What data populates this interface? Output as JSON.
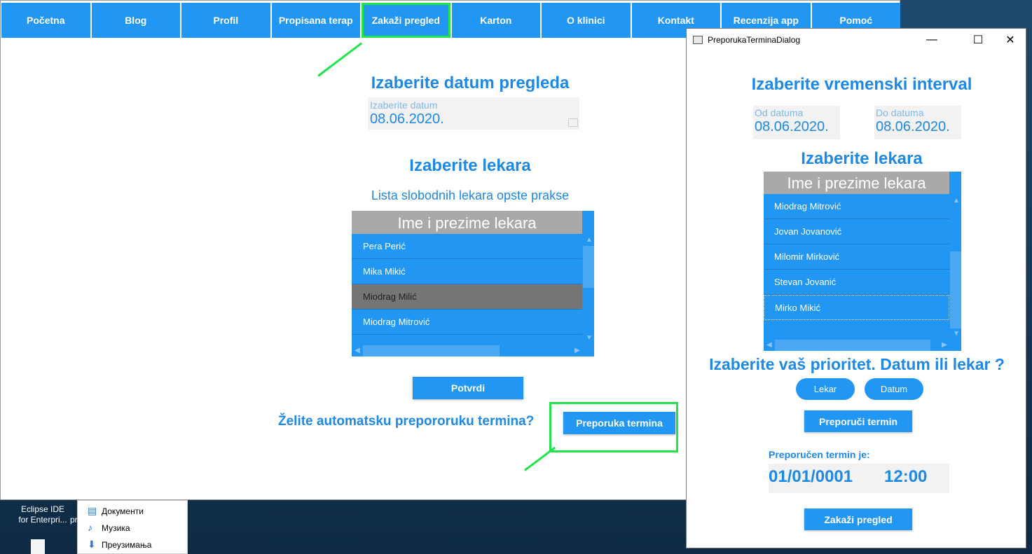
{
  "nav": {
    "items": [
      "Početna",
      "Blog",
      "Profil",
      "Propisana terap",
      "Zakaži pregled",
      "Karton",
      "O klinici",
      "Kontakt",
      "Recenzija app",
      "Pomoć"
    ]
  },
  "main": {
    "date_title": "Izaberite datum pregleda",
    "date_label": "Izaberite datum",
    "date_value": "08.06.2020.",
    "doctor_title": "Izaberite lekara",
    "doctor_subtitle": "Lista slobodnih lekara opste prakse",
    "list_header": "Ime i prezime lekara",
    "doctors": [
      "Pera Perić",
      "Mika Mikić",
      "Miodrag Milić",
      "Miodrag Mitrović"
    ],
    "selected_doctor": "Miodrag Milić",
    "confirm_button": "Potvrdi",
    "auto_question": "Želite automatsku prepororuku termina?",
    "recommend_button": "Preporuka termina"
  },
  "dialog": {
    "window_title": "PreporukaTerminaDialog",
    "interval_title": "Izaberite vremenski interval",
    "from_label": "Od datuma",
    "from_value": "08.06.2020.",
    "to_label": "Do datuma",
    "to_value": "08.06.2020.",
    "doctor_title": "Izaberite lekara",
    "list_header": "Ime i prezime lekara",
    "doctors": [
      "Miodrag Mitrović",
      "Jovan Jovanović",
      "Milomir Mirković",
      "Stevan Jovanić",
      "Mirko Mikić"
    ],
    "priority_title": "Izaberite vaš prioritet. Datum ili lekar ?",
    "priority_doctor": "Lekar",
    "priority_date": "Datum",
    "recommend_button": "Preporuči termin",
    "recommended_label": "Preporučen termin je:",
    "recommended_date": "01/01/0001",
    "recommended_time": "12:00",
    "schedule_button": "Zakaži pregled"
  },
  "taskbar": {
    "app_line1": "Eclipse IDE",
    "app_line2": "for Enterpri...",
    "partial": "pr"
  },
  "explorer": {
    "items": [
      "Документи",
      "Музика",
      "Преузимања"
    ]
  },
  "colors": {
    "accent": "#2196f3",
    "title_blue": "#1e88e5",
    "highlight": "#22e44a",
    "header_gray": "#a9a9a9",
    "selected_row": "#757575"
  }
}
